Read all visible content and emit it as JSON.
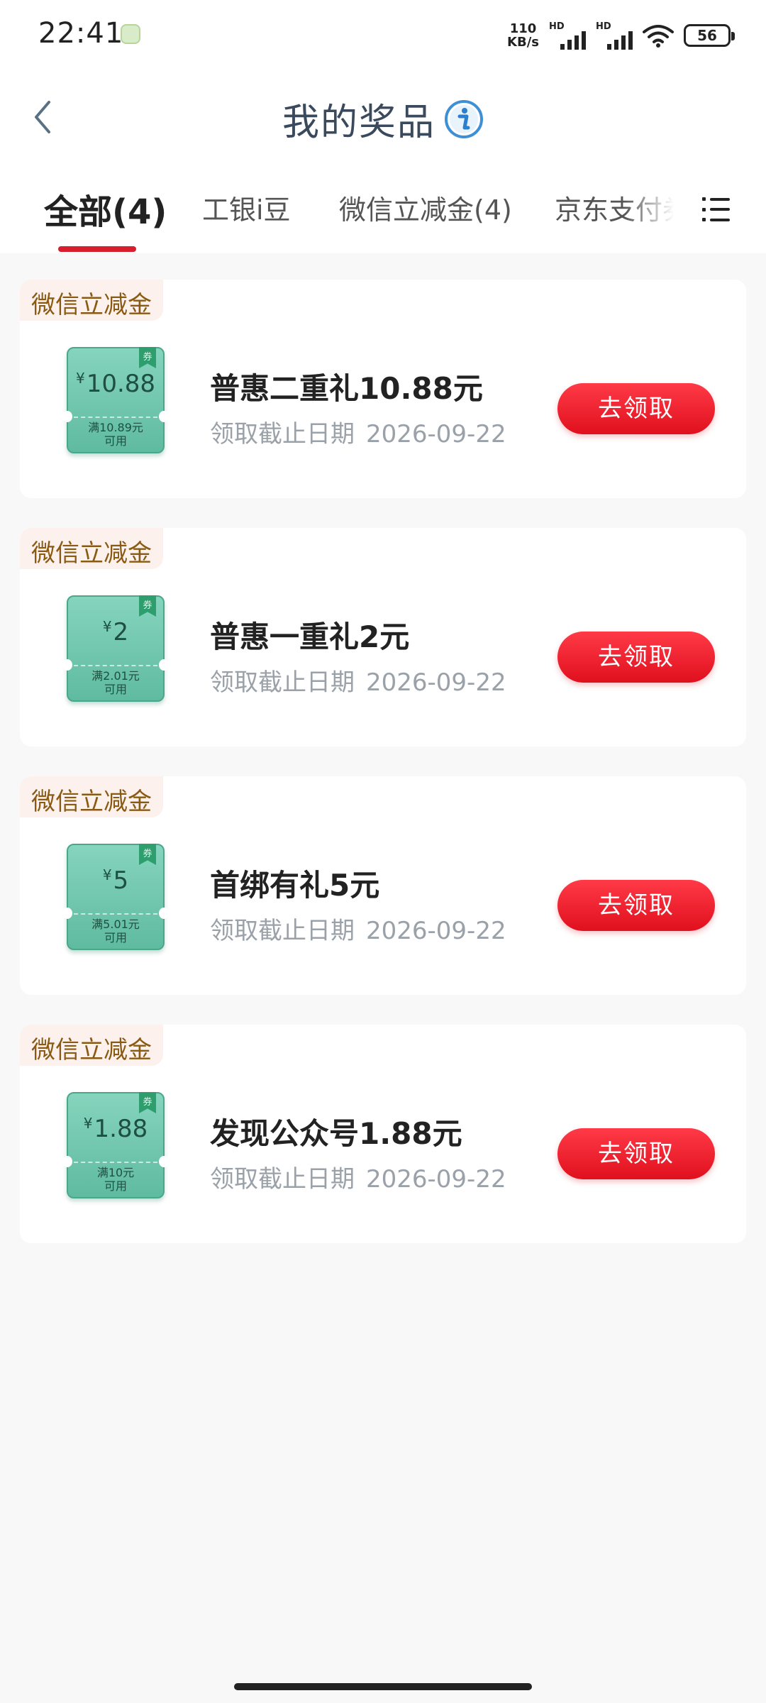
{
  "status_bar": {
    "time": "22:41",
    "net_speed_value": "110",
    "net_speed_unit": "KB/s",
    "sim1_label": "HD",
    "sim2_label": "HD",
    "battery": "56"
  },
  "header": {
    "title": "我的奖品",
    "back_icon": "chevron-left-icon",
    "info_icon": "info-icon"
  },
  "tabs": [
    {
      "label": "全部(4)",
      "active": true
    },
    {
      "label": "工银i豆",
      "active": false
    },
    {
      "label": "微信立减金(4)",
      "active": false
    },
    {
      "label": "京东支付券",
      "active": false
    }
  ],
  "colors": {
    "accent_red": "#e0101e",
    "coupon_green": "#5fbba0",
    "tag_text": "#8a5a12"
  },
  "prizes": [
    {
      "tag": "微信立减金",
      "coupon_amount": "10.88",
      "coupon_currency": "¥",
      "coupon_condition_line1": "满10.89元",
      "coupon_condition_line2": "可用",
      "coupon_ribbon": "券",
      "title": "普惠二重礼10.88元",
      "date_label": "领取截止日期",
      "date_value": "2026-09-22",
      "button_label": "去领取"
    },
    {
      "tag": "微信立减金",
      "coupon_amount": "2",
      "coupon_currency": "¥",
      "coupon_condition_line1": "满2.01元",
      "coupon_condition_line2": "可用",
      "coupon_ribbon": "券",
      "title": "普惠一重礼2元",
      "date_label": "领取截止日期",
      "date_value": "2026-09-22",
      "button_label": "去领取"
    },
    {
      "tag": "微信立减金",
      "coupon_amount": "5",
      "coupon_currency": "¥",
      "coupon_condition_line1": "满5.01元",
      "coupon_condition_line2": "可用",
      "coupon_ribbon": "券",
      "title": "首绑有礼5元",
      "date_label": "领取截止日期",
      "date_value": "2026-09-22",
      "button_label": "去领取"
    },
    {
      "tag": "微信立减金",
      "coupon_amount": "1.88",
      "coupon_currency": "¥",
      "coupon_condition_line1": "满10元",
      "coupon_condition_line2": "可用",
      "coupon_ribbon": "券",
      "title": "发现公众号1.88元",
      "date_label": "领取截止日期",
      "date_value": "2026-09-22",
      "button_label": "去领取"
    }
  ]
}
